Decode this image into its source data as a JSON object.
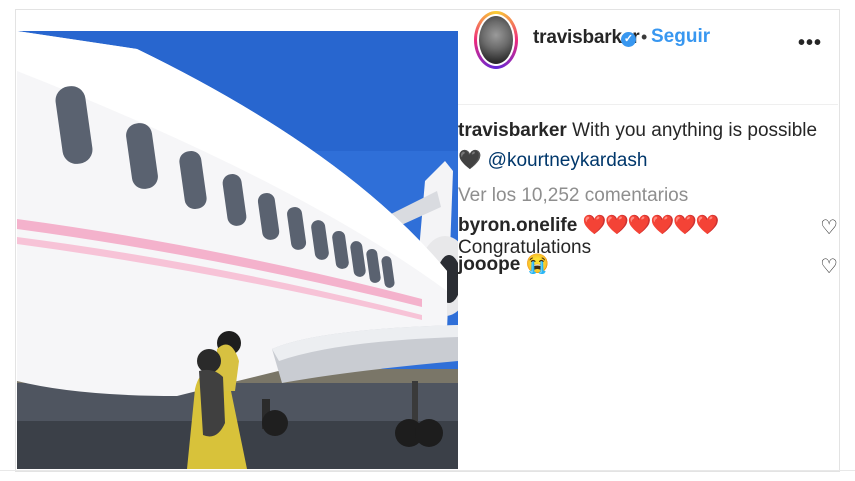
{
  "header": {
    "username": "travisbarker",
    "verified_symbol": "✓",
    "separator": "•",
    "follow_label": "Seguir",
    "more_label": "•••"
  },
  "caption": {
    "username": "travisbarker",
    "text": "With you anything is possible",
    "emoji": "🖤",
    "mention": "@kourtneykardash"
  },
  "view_comments_label": "Ver los 10,252 comentarios",
  "comments": [
    {
      "username": "byron.onelife",
      "emojis": "❤️❤️❤️❤️❤️❤️",
      "text": "Congratulations",
      "like_icon": "♡"
    },
    {
      "username": "jooope",
      "emojis": "😭",
      "text": "",
      "like_icon": "♡"
    }
  ],
  "colors": {
    "link_blue": "#3897f0",
    "mention_blue": "#00376b",
    "text": "#262626",
    "muted": "#8e8e8e",
    "heart_red": "#e0102c"
  }
}
